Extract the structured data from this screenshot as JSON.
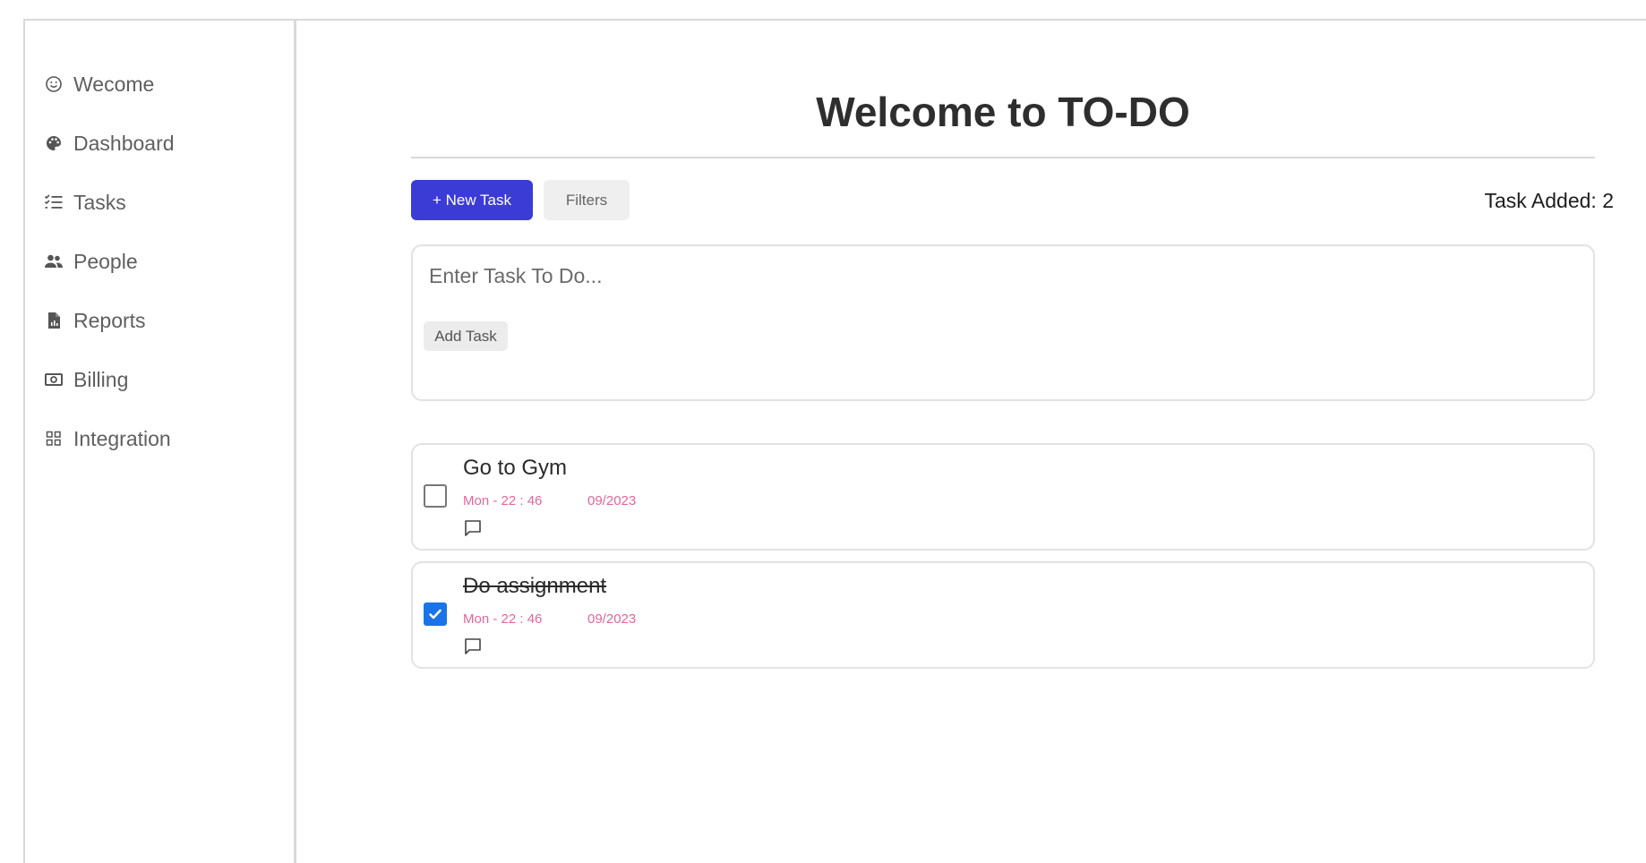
{
  "sidebar": {
    "items": [
      {
        "label": "Wecome",
        "icon": "smile-icon"
      },
      {
        "label": "Dashboard",
        "icon": "palette-icon"
      },
      {
        "label": "Tasks",
        "icon": "checklist-icon"
      },
      {
        "label": "People",
        "icon": "people-icon"
      },
      {
        "label": "Reports",
        "icon": "report-file-icon"
      },
      {
        "label": "Billing",
        "icon": "money-icon"
      },
      {
        "label": "Integration",
        "icon": "grid-icon"
      }
    ]
  },
  "main": {
    "title": "Welcome to TO-DO",
    "toolbar": {
      "new_task_label": "+ New Task",
      "filters_label": "Filters",
      "task_count": "Task Added: 2"
    },
    "entry": {
      "placeholder": "Enter Task To Do...",
      "value": "",
      "add_label": "Add Task"
    },
    "tasks": [
      {
        "title": "Go to Gym",
        "time": "Mon - 22 : 46",
        "date": "09/2023",
        "completed": false
      },
      {
        "title": "Do assignment",
        "time": "Mon - 22 : 46",
        "date": "09/2023",
        "completed": true
      }
    ]
  },
  "colors": {
    "accent": "#3b3bd6",
    "meta_text": "#e0679a",
    "checkbox_checked": "#1a73e8"
  }
}
